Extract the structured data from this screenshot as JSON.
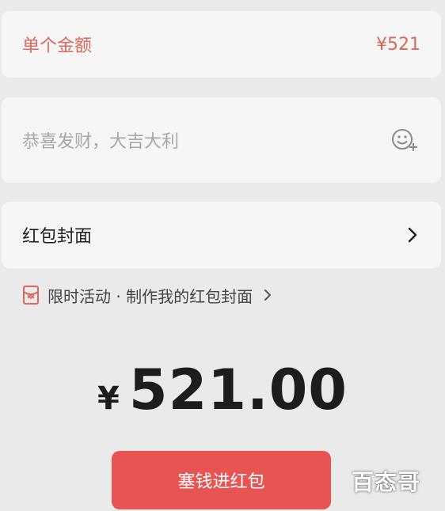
{
  "amount_row": {
    "label": "单个金额",
    "value": "¥521"
  },
  "greeting": {
    "placeholder": "恭喜发财，大吉大利",
    "emoji_icon": "emoji-add-icon"
  },
  "cover_row": {
    "label": "红包封面"
  },
  "promo": {
    "text": "限时活动 · 制作我的红包封面"
  },
  "total": {
    "currency": "¥",
    "amount": "521.00"
  },
  "submit": {
    "label": "塞钱进红包"
  },
  "watermark": {
    "text": "百态哥"
  },
  "colors": {
    "accent": "#e85452",
    "label_red": "#d9685d",
    "background": "#eaeaea",
    "card": "#f6f6f6"
  }
}
